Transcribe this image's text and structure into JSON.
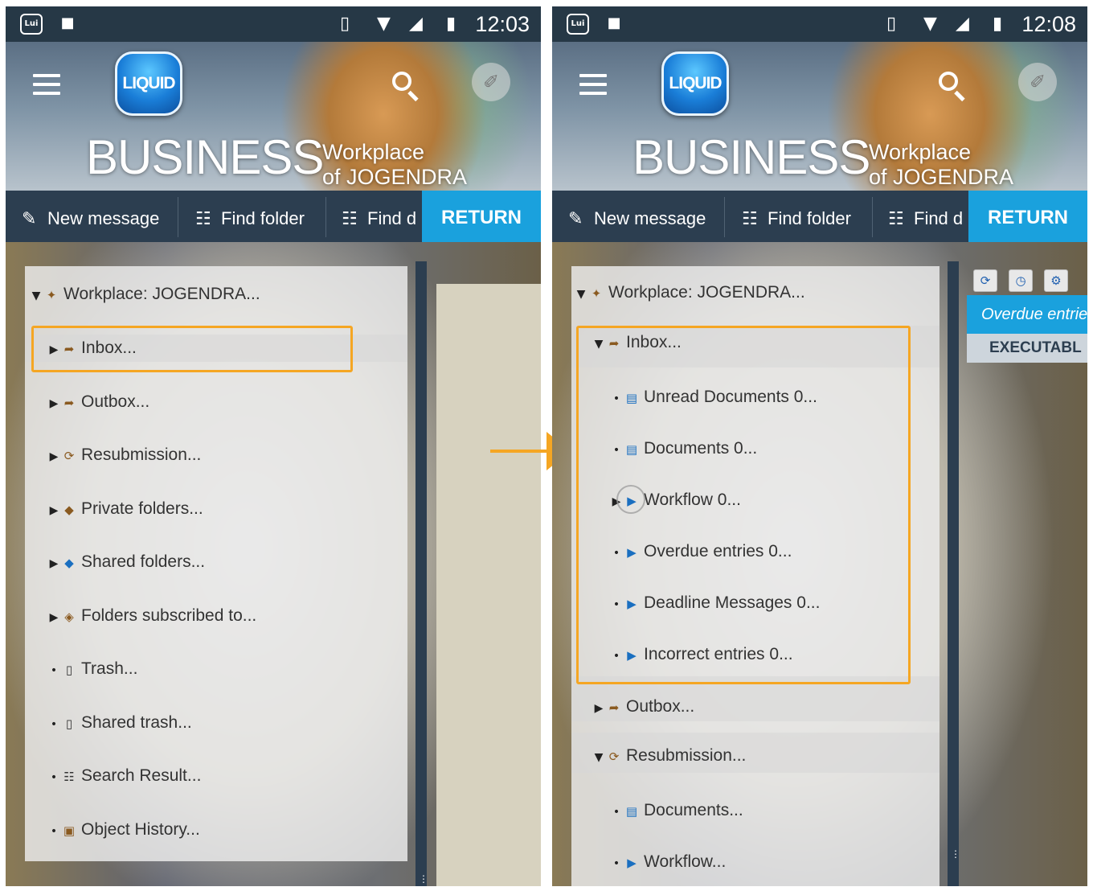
{
  "left": {
    "status": {
      "app_badge": "Lui",
      "time": "12:03"
    },
    "header": {
      "logo": "LIQUID",
      "brand": "BUSINESS",
      "subtitle_1": "Workplace",
      "subtitle_2": "of JOGENDRA"
    },
    "toolbar": {
      "new_message": "New message",
      "find_folder": "Find folder",
      "find_d": "Find d",
      "return": "RETURN"
    },
    "tree": {
      "root": "Workplace: JOGENDRA...",
      "items": [
        {
          "label": "Inbox..."
        },
        {
          "label": "Outbox..."
        },
        {
          "label": "Resubmission..."
        },
        {
          "label": "Private folders..."
        },
        {
          "label": "Shared folders..."
        },
        {
          "label": "Folders subscribed to..."
        },
        {
          "label": "Trash..."
        },
        {
          "label": "Shared trash..."
        },
        {
          "label": "Search Result..."
        },
        {
          "label": "Object History..."
        }
      ]
    }
  },
  "right": {
    "status": {
      "app_badge": "Lui",
      "time": "12:08"
    },
    "header": {
      "logo": "LIQUID",
      "brand": "BUSINESS",
      "subtitle_1": "Workplace",
      "subtitle_2": "of JOGENDRA"
    },
    "toolbar": {
      "new_message": "New message",
      "find_folder": "Find folder",
      "find_d": "Find d",
      "return": "RETURN"
    },
    "tree": {
      "root": "Workplace: JOGENDRA...",
      "inbox": "Inbox...",
      "inbox_children": [
        {
          "label": "Unread Documents 0..."
        },
        {
          "label": "Documents 0..."
        },
        {
          "label": "Workflow 0..."
        },
        {
          "label": "Overdue entries 0..."
        },
        {
          "label": "Deadline Messages 0..."
        },
        {
          "label": "Incorrect entries 0..."
        }
      ],
      "outbox": "Outbox...",
      "resubmission": "Resubmission...",
      "resubmission_children": [
        {
          "label": "Documents..."
        },
        {
          "label": "Workflow..."
        }
      ]
    },
    "side_panel": {
      "overdue_tab": "Overdue entrie",
      "executable": "EXECUTABL"
    }
  },
  "colors": {
    "highlight": "#f5a623",
    "toolbar": "#2c3e50",
    "return": "#1aa1dd",
    "statusbar": "#263846"
  }
}
